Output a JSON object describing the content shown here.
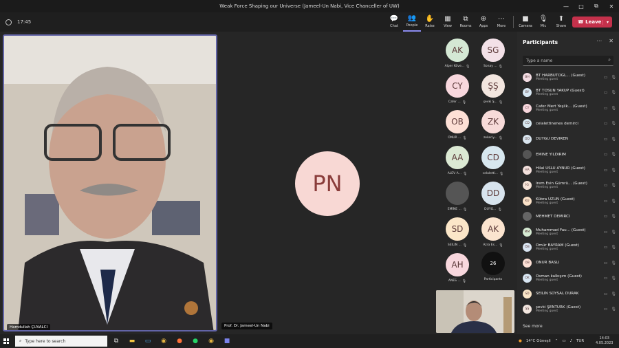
{
  "window": {
    "title": "Weak Force Shaping our Universe (Jameel-Un Nabi, Vice Chanceller of UW)",
    "controls": [
      "—",
      "□",
      "⧉",
      "✕"
    ]
  },
  "toolbar": {
    "timer": "17:45",
    "tools": [
      {
        "label": "Chat",
        "icon": "chat-icon",
        "glyph": "💬"
      },
      {
        "label": "People",
        "icon": "people-icon",
        "glyph": "👥"
      },
      {
        "label": "Raise",
        "icon": "hand-icon",
        "glyph": "✋"
      },
      {
        "label": "View",
        "icon": "grid-icon",
        "glyph": "▦"
      },
      {
        "label": "Rooms",
        "icon": "rooms-icon",
        "glyph": "⧉"
      },
      {
        "label": "Apps",
        "icon": "apps-icon",
        "glyph": "⊕"
      },
      {
        "label": "More",
        "icon": "more-icon",
        "glyph": "⋯"
      }
    ],
    "media": [
      {
        "label": "Camera",
        "icon": "camera-icon",
        "glyph": "■"
      },
      {
        "label": "Mic",
        "icon": "mic-off-icon",
        "glyph": "🎙"
      },
      {
        "label": "Share",
        "icon": "share-icon",
        "glyph": "⬆"
      }
    ],
    "leave_label": "Leave",
    "active_tool": "People"
  },
  "stage": {
    "main_name": "Hamdullah ÇUVALCI",
    "pn_initials": "PN",
    "pn_name": "Prof. Dr. Jameel-Un Nabi",
    "grid": [
      {
        "initials": "AK",
        "label": "Alper Köve...",
        "color": "#d4e8d4"
      },
      {
        "initials": "SG",
        "label": "Sonay ...",
        "color": "#f3e1e8"
      },
      {
        "initials": "CY",
        "label": "Cafer ...",
        "color": "#f8d7dd"
      },
      {
        "initials": "ŞŞ",
        "label": "şevki Ş...",
        "color": "#f3e6df"
      },
      {
        "initials": "OB",
        "label": "ONUR ...",
        "color": "#fde0d6"
      },
      {
        "initials": "ZK",
        "label": "zekeriy...",
        "color": "#f7dbd9"
      },
      {
        "initials": "AA",
        "label": "ALEV A...",
        "color": "#dbe9d3"
      },
      {
        "initials": "CD",
        "label": "celaletti...",
        "color": "#d7e7ef"
      },
      {
        "initials": "",
        "label": "EMİNE ...",
        "color": "#555555"
      },
      {
        "initials": "DD",
        "label": "DUYG...",
        "color": "#d8e4ee"
      },
      {
        "initials": "SD",
        "label": "SEILIN ...",
        "color": "#fbe6c8"
      },
      {
        "initials": "AK",
        "label": "Azra Es...",
        "color": "#fbe4cf"
      },
      {
        "initials": "AH",
        "label": "ANES ...",
        "color": "#f8d7dd"
      }
    ],
    "overflow_count": "26",
    "overflow_label": "Participants"
  },
  "panel": {
    "title": "Participants",
    "search_placeholder": "Type a name",
    "participants": [
      {
        "initials": "BH",
        "name": "BT HARBUTOGL... (Guest)",
        "sub": "Meeting guest",
        "color": "#f3dce3"
      },
      {
        "initials": "BY",
        "name": "BT TOSUN YAKUP (Guest)",
        "sub": "Meeting guest",
        "color": "#d8e7f3"
      },
      {
        "initials": "CY",
        "name": "Cafer Mert Yeşilk... (Guest)",
        "sub": "Meeting guest",
        "color": "#f8d7dd"
      },
      {
        "initials": "CD",
        "name": "celalettinenes demirci",
        "sub": "",
        "color": "#d7e7ef"
      },
      {
        "initials": "DD",
        "name": "DUYGU DEVİREN",
        "sub": "",
        "color": "#d8e4ee"
      },
      {
        "initials": "",
        "name": "EMİNE YILDIRIM",
        "sub": "",
        "color": "#555555"
      },
      {
        "initials": "HA",
        "name": "Hilal USLU AYNUR (Guest)",
        "sub": "Meeting guest",
        "color": "#f3e0dc"
      },
      {
        "initials": "İG",
        "name": "İrem Esin Gümrü... (Guest)",
        "sub": "Meeting guest",
        "color": "#f6e4d8"
      },
      {
        "initials": "KU",
        "name": "Kübra UZUN (Guest)",
        "sub": "Meeting guest",
        "color": "#fbe2c8"
      },
      {
        "initials": "",
        "name": "MEHMET DEMİRCİ",
        "sub": "",
        "color": "#666666"
      },
      {
        "initials": "MM",
        "name": "Muhammad Fau... (Guest)",
        "sub": "Meeting guest",
        "color": "#d6ead3"
      },
      {
        "initials": "ÖB",
        "name": "Ömür BAYRAM (Guest)",
        "sub": "Meeting guest",
        "color": "#d9e4f1"
      },
      {
        "initials": "OB",
        "name": "ONUR BASLI",
        "sub": "",
        "color": "#fde0d6"
      },
      {
        "initials": "OK",
        "name": "Osman kalkışım (Guest)",
        "sub": "Meeting guest",
        "color": "#d8e6f2"
      },
      {
        "initials": "SD",
        "name": "SEILIN SOYSAL DURAK",
        "sub": "",
        "color": "#fbe6c8"
      },
      {
        "initials": "ŞŞ",
        "name": "şevki ŞENTÜRK (Guest)",
        "sub": "Meeting guest",
        "color": "#f3e6df"
      }
    ],
    "see_more": "See more"
  },
  "taskbar": {
    "search_placeholder": "Type here to search",
    "weather": "14°C Güneşli",
    "lang": "TUR",
    "time": "14:03",
    "date": "4.05.2023"
  }
}
